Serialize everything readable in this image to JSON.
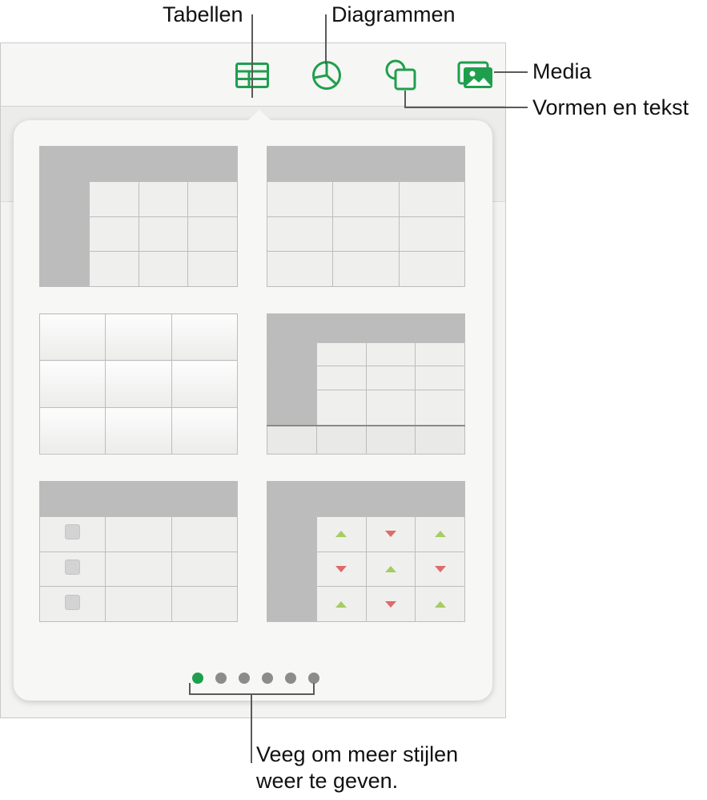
{
  "callouts": {
    "tables": "Tabellen",
    "charts": "Diagrammen",
    "media": "Media",
    "shapes_text": "Vormen en tekst",
    "swipe_line1": "Veeg om meer stijlen",
    "swipe_line2": "weer te geven."
  },
  "toolbar": {
    "buttons": [
      {
        "name": "tables-button",
        "icon": "table-icon"
      },
      {
        "name": "charts-button",
        "icon": "pie-chart-icon"
      },
      {
        "name": "shapes-button",
        "icon": "shapes-icon"
      },
      {
        "name": "media-button",
        "icon": "photo-icon"
      }
    ],
    "accent_color": "#1f9f4d"
  },
  "popover": {
    "table_styles": [
      {
        "name": "table-style-1",
        "variant": "header-row-and-column-gray"
      },
      {
        "name": "table-style-2",
        "variant": "header-row-gray"
      },
      {
        "name": "table-style-3",
        "variant": "plain-white-gradient"
      },
      {
        "name": "table-style-4",
        "variant": "header-row-column-and-footer"
      },
      {
        "name": "table-style-5",
        "variant": "checkbox-column"
      },
      {
        "name": "table-style-6",
        "variant": "trend-arrows"
      }
    ],
    "pages": {
      "count": 6,
      "current": 1
    }
  }
}
